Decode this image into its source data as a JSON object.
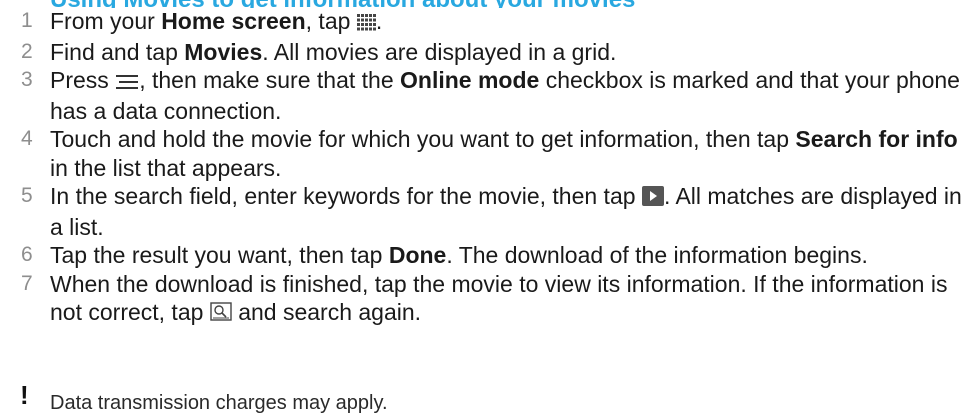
{
  "title": "Using Movies to get information about your movies",
  "steps": [
    {
      "num": "1",
      "a": "From your ",
      "b": "Home screen",
      "c": ", tap ",
      "icon": "app-grid-icon",
      "d": "."
    },
    {
      "num": "2",
      "a": "Find and tap ",
      "b": "Movies",
      "c": ". All movies are displayed in a grid."
    },
    {
      "num": "3",
      "a": "Press ",
      "icon": "menu-icon",
      "c": ", then make sure that the ",
      "b": "Online mode",
      "d": " checkbox is marked and that your phone has a data connection."
    },
    {
      "num": "4",
      "a": "Touch and hold the movie for which you want to get information, then tap ",
      "b": "Search for info",
      "c": " in the list that appears."
    },
    {
      "num": "5",
      "a": "In the search field, enter keywords for the movie, then tap ",
      "icon": "play-icon",
      "c": ". All matches are displayed in a list."
    },
    {
      "num": "6",
      "a": "Tap the result you want, then tap ",
      "b": "Done",
      "c": ". The download of the information begins."
    },
    {
      "num": "7",
      "a": "When the download is finished, tap the movie to view its information. If the information is not correct, tap ",
      "icon": "search-again-icon",
      "c": " and search again."
    }
  ],
  "note": {
    "icon": "exclamation-icon",
    "glyph": "!",
    "text": "Data transmission charges may apply."
  }
}
